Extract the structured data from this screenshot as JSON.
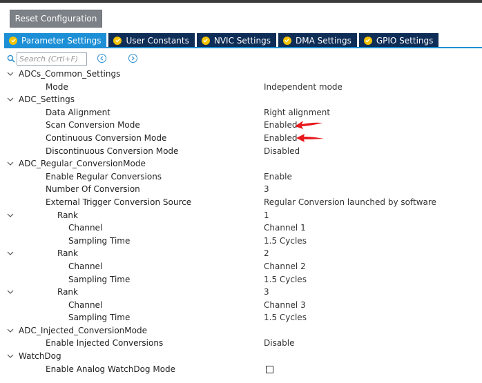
{
  "toolbar": {
    "reset_label": "Reset Configuration"
  },
  "tabs": [
    {
      "label": "Parameter Settings",
      "active": true
    },
    {
      "label": "User Constants",
      "active": false
    },
    {
      "label": "NVIC Settings",
      "active": false
    },
    {
      "label": "DMA Settings",
      "active": false
    },
    {
      "label": "GPIO Settings",
      "active": false
    }
  ],
  "search": {
    "placeholder": "Search (Crtl+F)"
  },
  "tree": {
    "adcs_common": {
      "label": "ADCs_Common_Settings",
      "mode_label": "Mode",
      "mode_value": "Independent mode"
    },
    "adc_settings": {
      "label": "ADC_Settings",
      "data_alignment": {
        "label": "Data Alignment",
        "value": "Right alignment"
      },
      "scan": {
        "label": "Scan Conversion Mode",
        "value": "Enabled"
      },
      "continuous": {
        "label": "Continuous Conversion Mode",
        "value": "Enabled"
      },
      "discontinuous": {
        "label": "Discontinuous Conversion Mode",
        "value": "Disabled"
      }
    },
    "regular": {
      "label": "ADC_Regular_ConversionMode",
      "enable": {
        "label": "Enable Regular Conversions",
        "value": "Enable"
      },
      "number": {
        "label": "Number Of Conversion",
        "value": "3"
      },
      "trigger": {
        "label": "External Trigger Conversion Source",
        "value": "Regular Conversion launched by software"
      },
      "ranks": [
        {
          "label": "Rank",
          "value": "1",
          "channel_label": "Channel",
          "channel_value": "Channel 1",
          "sampling_label": "Sampling Time",
          "sampling_value": "1.5 Cycles"
        },
        {
          "label": "Rank",
          "value": "2",
          "channel_label": "Channel",
          "channel_value": "Channel 2",
          "sampling_label": "Sampling Time",
          "sampling_value": "1.5 Cycles"
        },
        {
          "label": "Rank",
          "value": "3",
          "channel_label": "Channel",
          "channel_value": "Channel 3",
          "sampling_label": "Sampling Time",
          "sampling_value": "1.5 Cycles"
        }
      ]
    },
    "injected": {
      "label": "ADC_Injected_ConversionMode",
      "enable": {
        "label": "Enable Injected Conversions",
        "value": "Disable"
      }
    },
    "watchdog": {
      "label": "WatchDog",
      "enable": {
        "label": "Enable Analog WatchDog Mode",
        "checked": false
      }
    }
  },
  "colors": {
    "tab_active": "#1c8fd6",
    "tab_inactive": "#0f2e57",
    "tab_icon": "#f3c300",
    "annotation_arrow": "#e8191c"
  }
}
